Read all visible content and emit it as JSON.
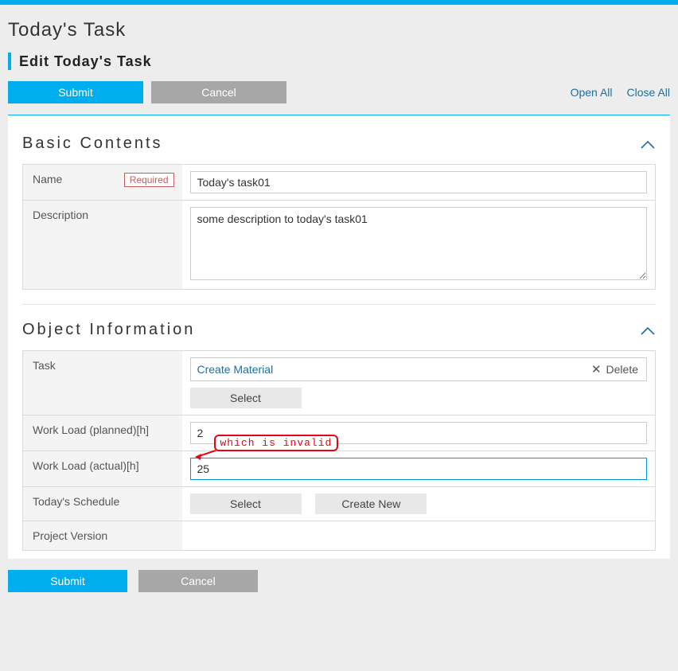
{
  "header": {
    "page_title": "Today's Task",
    "edit_title": "Edit Today's Task"
  },
  "toolbar": {
    "submit_label": "Submit",
    "cancel_label": "Cancel",
    "open_all_label": "Open All",
    "close_all_label": "Close All"
  },
  "sections": {
    "basic_contents": {
      "title": "Basic Contents",
      "fields": {
        "name": {
          "label": "Name",
          "required_label": "Required",
          "value": "Today's task01"
        },
        "description": {
          "label": "Description",
          "value": "some description to today's task01"
        }
      }
    },
    "object_information": {
      "title": "Object Information",
      "fields": {
        "task": {
          "label": "Task"
        },
        "workload_planned": {
          "label": "Work Load (planned)[h]",
          "value": "2"
        },
        "workload_actual": {
          "label": "Work Load (actual)[h]",
          "value": "25"
        },
        "todays_schedule": {
          "label": "Today's Schedule"
        },
        "project_version": {
          "label": "Project Version"
        }
      },
      "task_link": {
        "name": "Create Material",
        "delete_label": "Delete"
      },
      "buttons": {
        "select_label": "Select",
        "create_new_label": "Create New"
      }
    }
  },
  "annotation": {
    "text": "which is invalid"
  },
  "colors": {
    "primary": "#00aeef",
    "link": "#1d6fa5",
    "error": "#e30613",
    "required": "#c95b5b"
  }
}
